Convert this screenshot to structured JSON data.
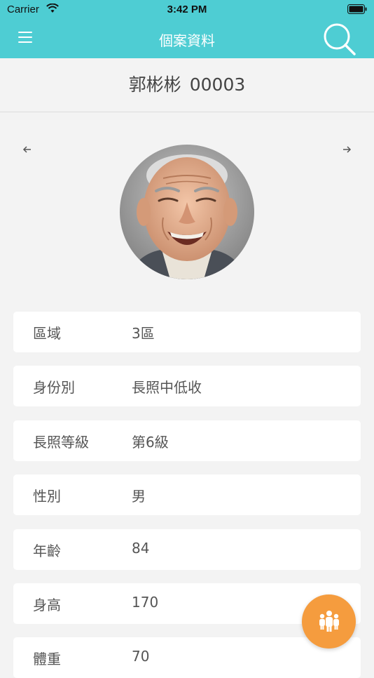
{
  "status_bar": {
    "carrier": "Carrier",
    "time": "3:42 PM"
  },
  "nav": {
    "title": "個案資料",
    "menu_icon": "hamburger-menu-icon",
    "search_icon": "search-icon"
  },
  "client": {
    "name": "郭彬彬",
    "id": "00003"
  },
  "photo_nav": {
    "prev_icon": "arrow-left-icon",
    "next_icon": "arrow-right-icon"
  },
  "info": [
    {
      "label": "區域",
      "value": "3區"
    },
    {
      "label": "身份別",
      "value": "長照中低收"
    },
    {
      "label": "長照等級",
      "value": "第6級"
    },
    {
      "label": "性別",
      "value": "男"
    },
    {
      "label": "年齡",
      "value": "84"
    },
    {
      "label": "身高",
      "value": "170"
    },
    {
      "label": "體重",
      "value": "70"
    }
  ],
  "fab": {
    "icon": "group-people-icon"
  },
  "colors": {
    "header": "#4ecdd3",
    "background": "#f3f3f3",
    "fab": "#f59c3e"
  }
}
